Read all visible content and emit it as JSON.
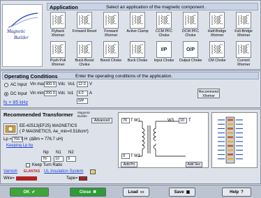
{
  "logo": {
    "line1": "Magnetic",
    "line2": "Builder"
  },
  "application": {
    "title": "Application",
    "description": "Select an application of the magnetic component .",
    "topologies": [
      {
        "label": "Flyback Xformer",
        "icon": "flyback-icon"
      },
      {
        "label": "Forward Reset",
        "icon": "forward-reset-icon"
      },
      {
        "label": "Forward Xformer",
        "icon": "forward-xformer-icon"
      },
      {
        "label": "Active Clamp",
        "icon": "active-clamp-icon"
      },
      {
        "label": "CCM PFC Choke",
        "icon": "ccm-pfc-icon"
      },
      {
        "label": "DCM PFC Choke",
        "icon": "dcm-pfc-icon"
      },
      {
        "label": "Half-Bridge Xformer",
        "icon": "half-bridge-icon"
      },
      {
        "label": "Full-Bridge Xformer",
        "icon": "full-bridge-icon"
      },
      {
        "label": "Push Pull Xformer",
        "icon": "push-pull-icon"
      },
      {
        "label": "Buck-Boost Choke",
        "icon": "buck-boost-icon"
      },
      {
        "label": "Boost Choke",
        "icon": "boost-choke-icon"
      },
      {
        "label": "Buck Choke",
        "icon": "buck-choke-icon"
      },
      {
        "label": "Input Choke",
        "icon": "input-choke-icon",
        "text": "I/P"
      },
      {
        "label": "Output Choke",
        "icon": "output-choke-icon",
        "text": "O/P"
      },
      {
        "label": "CM Choke",
        "icon": "cm-choke-icon"
      },
      {
        "label": "Current Xformer",
        "icon": "current-xformer-icon"
      }
    ]
  },
  "operating": {
    "title": "Operating Conditions",
    "description": "Enter the operating conditions of the application.",
    "ac_label": "AC Input",
    "dc_label": "DC Input",
    "vin_max_label": "Vin max",
    "vin_max": "400.0",
    "vin_max_unit": "Vdc",
    "vin_min_label": "Vin min",
    "vin_min": "200.0",
    "vin_min_unit": "Vdc",
    "vo1_label": "Vo1",
    "vo1": "12.0",
    "vo1_unit": "V",
    "io1_label": "Io1",
    "io1": "4.0",
    "io1_unit": "A",
    "fs_label": "fs = 85 kHz",
    "recommend_button": "Recommend Xformer",
    "select_value": "0/P"
  },
  "transformer": {
    "title": "Recommended Transformer",
    "brand": "Magnetic Builder",
    "advanced_button": "Advanced",
    "core_line1": "EE-42513(EF25) MAGNETICS",
    "core_line2": "( P MAGNETICS, Ae_min=0.518cm²)",
    "lp_label": "Lp =",
    "lp_value": "766.9",
    "lp_unit": "H",
    "bm_text": "(ΔBm = 776.7 uH)",
    "keeping_lp": "Keeping Lp by",
    "n_headers": [
      "Np",
      "N1",
      "N2"
    ],
    "n_values": [
      "76",
      "10",
      "9"
    ],
    "keep_turn_ratio": "Keep Turn Ratio",
    "varnish_label": "Varnish",
    "elantas_label": "ELANTAS",
    "ul_label": "UL Insulation System",
    "wire_label": "Wire=",
    "tape_label": "Tape=",
    "winding_p_turns": "76",
    "winding_w1": "W1",
    "winding_w3": "W3",
    "winding_w3_turns": "10",
    "winding_w3_type": "T",
    "winding_bottom_turns": "9",
    "winding_w2": "W2",
    "add_pri": "Add Pri",
    "add_sec": "Add Sec"
  },
  "bottom": {
    "ok": "OK",
    "close": "Close",
    "load": "Load",
    "save": "Save",
    "help": "Help"
  }
}
